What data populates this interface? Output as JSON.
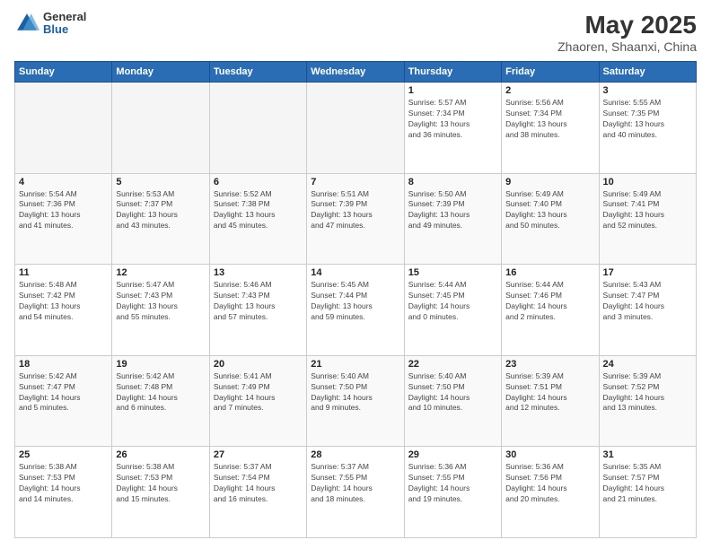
{
  "header": {
    "logo": {
      "general": "General",
      "blue": "Blue"
    },
    "title": "May 2025",
    "subtitle": "Zhaoren, Shaanxi, China"
  },
  "weekdays": [
    "Sunday",
    "Monday",
    "Tuesday",
    "Wednesday",
    "Thursday",
    "Friday",
    "Saturday"
  ],
  "weeks": [
    [
      {
        "day": "",
        "info": ""
      },
      {
        "day": "",
        "info": ""
      },
      {
        "day": "",
        "info": ""
      },
      {
        "day": "",
        "info": ""
      },
      {
        "day": "1",
        "info": "Sunrise: 5:57 AM\nSunset: 7:34 PM\nDaylight: 13 hours\nand 36 minutes."
      },
      {
        "day": "2",
        "info": "Sunrise: 5:56 AM\nSunset: 7:34 PM\nDaylight: 13 hours\nand 38 minutes."
      },
      {
        "day": "3",
        "info": "Sunrise: 5:55 AM\nSunset: 7:35 PM\nDaylight: 13 hours\nand 40 minutes."
      }
    ],
    [
      {
        "day": "4",
        "info": "Sunrise: 5:54 AM\nSunset: 7:36 PM\nDaylight: 13 hours\nand 41 minutes."
      },
      {
        "day": "5",
        "info": "Sunrise: 5:53 AM\nSunset: 7:37 PM\nDaylight: 13 hours\nand 43 minutes."
      },
      {
        "day": "6",
        "info": "Sunrise: 5:52 AM\nSunset: 7:38 PM\nDaylight: 13 hours\nand 45 minutes."
      },
      {
        "day": "7",
        "info": "Sunrise: 5:51 AM\nSunset: 7:39 PM\nDaylight: 13 hours\nand 47 minutes."
      },
      {
        "day": "8",
        "info": "Sunrise: 5:50 AM\nSunset: 7:39 PM\nDaylight: 13 hours\nand 49 minutes."
      },
      {
        "day": "9",
        "info": "Sunrise: 5:49 AM\nSunset: 7:40 PM\nDaylight: 13 hours\nand 50 minutes."
      },
      {
        "day": "10",
        "info": "Sunrise: 5:49 AM\nSunset: 7:41 PM\nDaylight: 13 hours\nand 52 minutes."
      }
    ],
    [
      {
        "day": "11",
        "info": "Sunrise: 5:48 AM\nSunset: 7:42 PM\nDaylight: 13 hours\nand 54 minutes."
      },
      {
        "day": "12",
        "info": "Sunrise: 5:47 AM\nSunset: 7:43 PM\nDaylight: 13 hours\nand 55 minutes."
      },
      {
        "day": "13",
        "info": "Sunrise: 5:46 AM\nSunset: 7:43 PM\nDaylight: 13 hours\nand 57 minutes."
      },
      {
        "day": "14",
        "info": "Sunrise: 5:45 AM\nSunset: 7:44 PM\nDaylight: 13 hours\nand 59 minutes."
      },
      {
        "day": "15",
        "info": "Sunrise: 5:44 AM\nSunset: 7:45 PM\nDaylight: 14 hours\nand 0 minutes."
      },
      {
        "day": "16",
        "info": "Sunrise: 5:44 AM\nSunset: 7:46 PM\nDaylight: 14 hours\nand 2 minutes."
      },
      {
        "day": "17",
        "info": "Sunrise: 5:43 AM\nSunset: 7:47 PM\nDaylight: 14 hours\nand 3 minutes."
      }
    ],
    [
      {
        "day": "18",
        "info": "Sunrise: 5:42 AM\nSunset: 7:47 PM\nDaylight: 14 hours\nand 5 minutes."
      },
      {
        "day": "19",
        "info": "Sunrise: 5:42 AM\nSunset: 7:48 PM\nDaylight: 14 hours\nand 6 minutes."
      },
      {
        "day": "20",
        "info": "Sunrise: 5:41 AM\nSunset: 7:49 PM\nDaylight: 14 hours\nand 7 minutes."
      },
      {
        "day": "21",
        "info": "Sunrise: 5:40 AM\nSunset: 7:50 PM\nDaylight: 14 hours\nand 9 minutes."
      },
      {
        "day": "22",
        "info": "Sunrise: 5:40 AM\nSunset: 7:50 PM\nDaylight: 14 hours\nand 10 minutes."
      },
      {
        "day": "23",
        "info": "Sunrise: 5:39 AM\nSunset: 7:51 PM\nDaylight: 14 hours\nand 12 minutes."
      },
      {
        "day": "24",
        "info": "Sunrise: 5:39 AM\nSunset: 7:52 PM\nDaylight: 14 hours\nand 13 minutes."
      }
    ],
    [
      {
        "day": "25",
        "info": "Sunrise: 5:38 AM\nSunset: 7:53 PM\nDaylight: 14 hours\nand 14 minutes."
      },
      {
        "day": "26",
        "info": "Sunrise: 5:38 AM\nSunset: 7:53 PM\nDaylight: 14 hours\nand 15 minutes."
      },
      {
        "day": "27",
        "info": "Sunrise: 5:37 AM\nSunset: 7:54 PM\nDaylight: 14 hours\nand 16 minutes."
      },
      {
        "day": "28",
        "info": "Sunrise: 5:37 AM\nSunset: 7:55 PM\nDaylight: 14 hours\nand 18 minutes."
      },
      {
        "day": "29",
        "info": "Sunrise: 5:36 AM\nSunset: 7:55 PM\nDaylight: 14 hours\nand 19 minutes."
      },
      {
        "day": "30",
        "info": "Sunrise: 5:36 AM\nSunset: 7:56 PM\nDaylight: 14 hours\nand 20 minutes."
      },
      {
        "day": "31",
        "info": "Sunrise: 5:35 AM\nSunset: 7:57 PM\nDaylight: 14 hours\nand 21 minutes."
      }
    ]
  ]
}
